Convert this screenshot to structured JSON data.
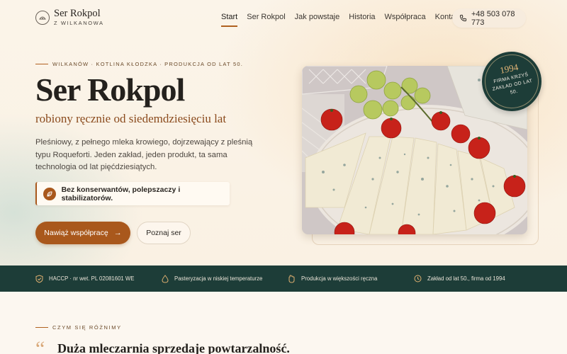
{
  "header": {
    "brand_title": "Ser Rokpol",
    "brand_subtitle": "Z WILKANOWA",
    "nav": [
      {
        "label": "Start",
        "active": true
      },
      {
        "label": "Ser Rokpol",
        "active": false
      },
      {
        "label": "Jak powstaje",
        "active": false
      },
      {
        "label": "Historia",
        "active": false
      },
      {
        "label": "Współpraca",
        "active": false
      },
      {
        "label": "Kontakt",
        "active": false
      }
    ],
    "phone": "+48 503 078 773"
  },
  "hero": {
    "eyebrow": "WILKANÓW · KOTLINA KŁODZKA · PRODUKCJA OD LAT 50.",
    "title": "Ser Rokpol",
    "subtitle": "robiony ręcznie od siedemdziesięciu lat",
    "description": "Pleśniowy, z pełnego mleka krowiego, dojrzewający z pleśnią typu Roqueforti. Jeden zakład, jeden produkt, ta sama technologia od lat pięćdziesiątych.",
    "badge": "Bez konserwantów, polepszaczy i stabilizatorów.",
    "cta_primary": "Nawiąż współpracę",
    "cta_secondary": "Poznaj ser",
    "stamp_year": "1994",
    "stamp_text": "FIRMA KRZYŚ ZAKŁAD OD LAT 50."
  },
  "trust_bar": [
    {
      "icon": "shield-check-icon",
      "label": "HACCP · nr wet. PL 02081601 WE"
    },
    {
      "icon": "drop-icon",
      "label": "Pasteryzacja w niskiej temperaturze"
    },
    {
      "icon": "hand-icon",
      "label": "Produkcja w większości ręczna"
    },
    {
      "icon": "clock-icon",
      "label": "Zakład od lat 50., firma od 1994"
    }
  ],
  "section": {
    "eyebrow": "CZYM SIĘ RÓŻNIMY",
    "title": "Duża mleczarnia sprzedaje powtarzalność."
  },
  "colors": {
    "accent": "#a9581c",
    "dark_green": "#1d3d38",
    "background": "#fbf6ee"
  }
}
